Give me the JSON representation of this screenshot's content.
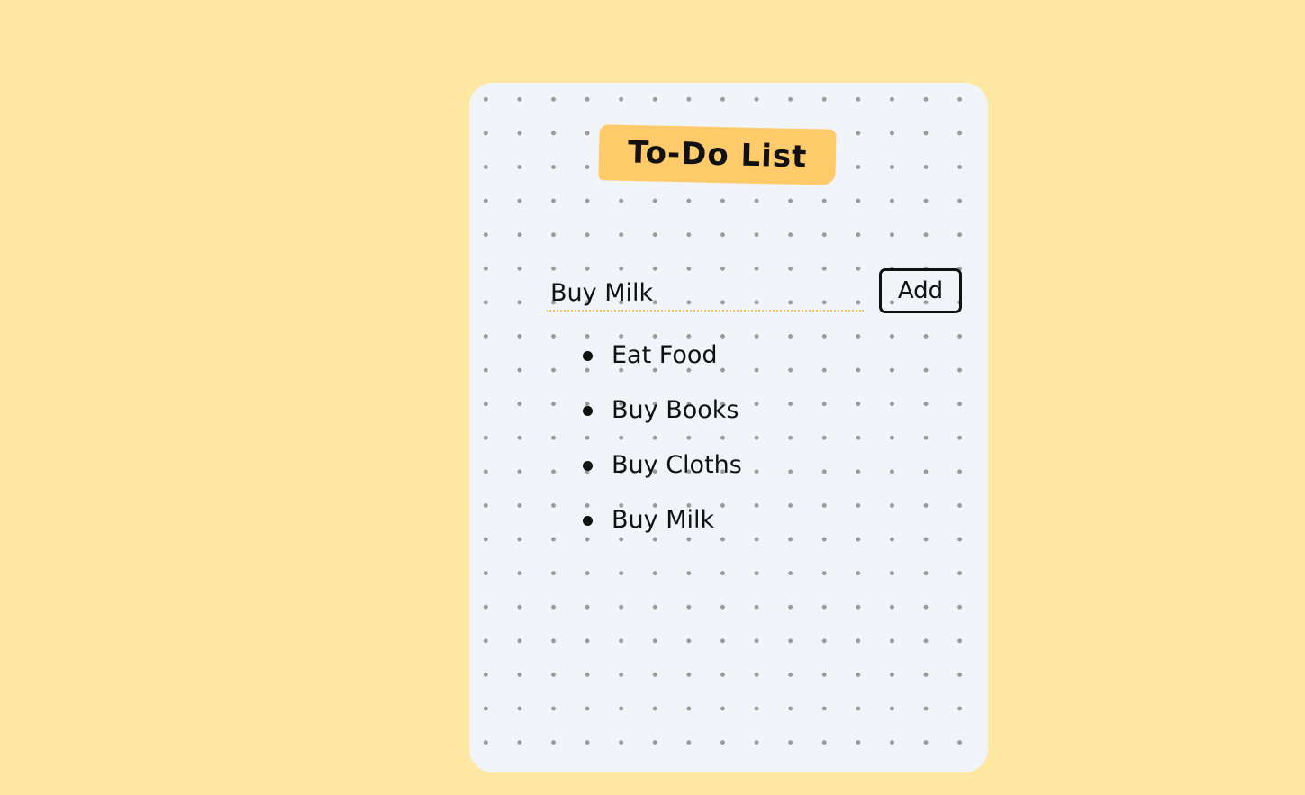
{
  "app": {
    "title": "To-Do List"
  },
  "input": {
    "value": "Buy Milk",
    "placeholder": ""
  },
  "add_button": {
    "label": "Add"
  },
  "todos": [
    {
      "label": "Eat Food"
    },
    {
      "label": "Buy Books"
    },
    {
      "label": "Buy Cloths"
    },
    {
      "label": "Buy Milk"
    }
  ],
  "colors": {
    "page_background": "#FFE8A4",
    "card_background": "#F1F4F9",
    "title_badge": "#FFCA6A",
    "input_underline": "#F4C06A",
    "text": "#111111"
  }
}
